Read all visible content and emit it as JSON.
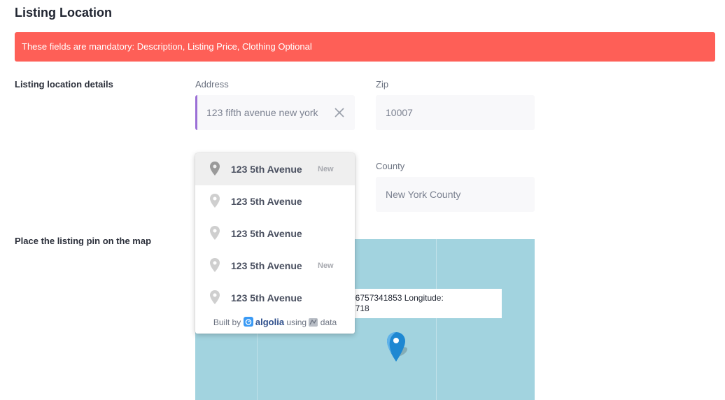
{
  "page": {
    "title": "Listing Location",
    "alert": "These fields are mandatory: Description, Listing Price, Clothing Optional"
  },
  "details": {
    "section_label": "Listing location details",
    "address": {
      "label": "Address",
      "value": "123 fifth avenue new york"
    },
    "zip": {
      "label": "Zip",
      "value": "10007"
    },
    "county": {
      "label": "County",
      "value": "New York County"
    }
  },
  "suggestions": {
    "items": [
      {
        "address": "123 5th Avenue",
        "badge": "New"
      },
      {
        "address": "123 5th Avenue",
        "badge": ""
      },
      {
        "address": "123 5th Avenue",
        "badge": ""
      },
      {
        "address": "123 5th Avenue",
        "badge": "New"
      },
      {
        "address": "123 5th Avenue",
        "badge": ""
      }
    ],
    "attribution": {
      "prefix": "Built by",
      "brand": "algolia",
      "middle": "using",
      "suffix": "data"
    }
  },
  "map": {
    "section_label": "Place the listing pin on the map",
    "info_line1": "76757341853 Longitude:",
    "info_line2": "2718"
  },
  "colors": {
    "alert_bg": "#fe5f57",
    "focus_accent": "#9b6fd6",
    "map_water": "#a2d3df",
    "pin_blue": "#1e88d2"
  }
}
